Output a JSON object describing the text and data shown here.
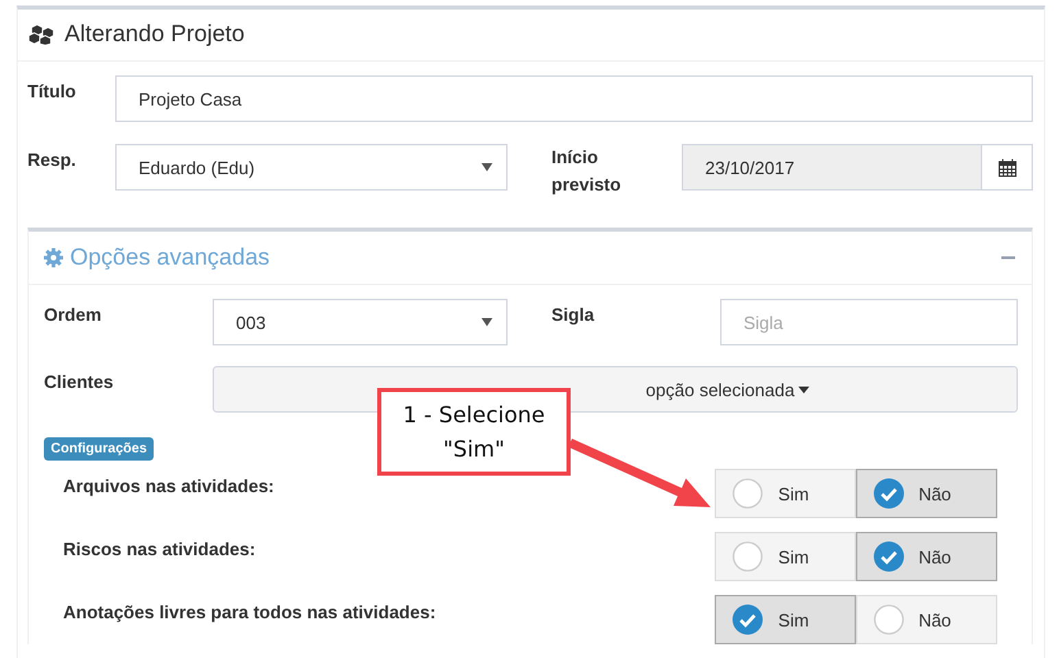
{
  "header": {
    "title": "Alterando Projeto"
  },
  "titulo": {
    "label": "Título",
    "value": "Projeto Casa"
  },
  "resp": {
    "label": "Resp.",
    "value": "Eduardo (Edu)"
  },
  "inicio": {
    "label": "Início previsto",
    "value": "23/10/2017"
  },
  "advanced": {
    "title": "Opções avançadas",
    "expanded": true
  },
  "ordem": {
    "label": "Ordem",
    "value": "003"
  },
  "sigla": {
    "label": "Sigla",
    "placeholder": "Sigla"
  },
  "clientes": {
    "label": "Clientes",
    "value": "opção selecionada"
  },
  "badge": "Configurações",
  "settings": [
    {
      "label": "Arquivos nas atividades:",
      "options": [
        {
          "label": "Sim",
          "selected": false
        },
        {
          "label": "Não",
          "selected": true
        }
      ]
    },
    {
      "label": "Riscos nas atividades:",
      "options": [
        {
          "label": "Sim",
          "selected": false
        },
        {
          "label": "Não",
          "selected": true
        }
      ]
    },
    {
      "label": "Anotações livres para todos nas atividades:",
      "options": [
        {
          "label": "Sim",
          "selected": true
        },
        {
          "label": "Não",
          "selected": false
        }
      ]
    }
  ],
  "callout": {
    "lines": [
      "1 - Selecione",
      "\"Sim\""
    ]
  }
}
